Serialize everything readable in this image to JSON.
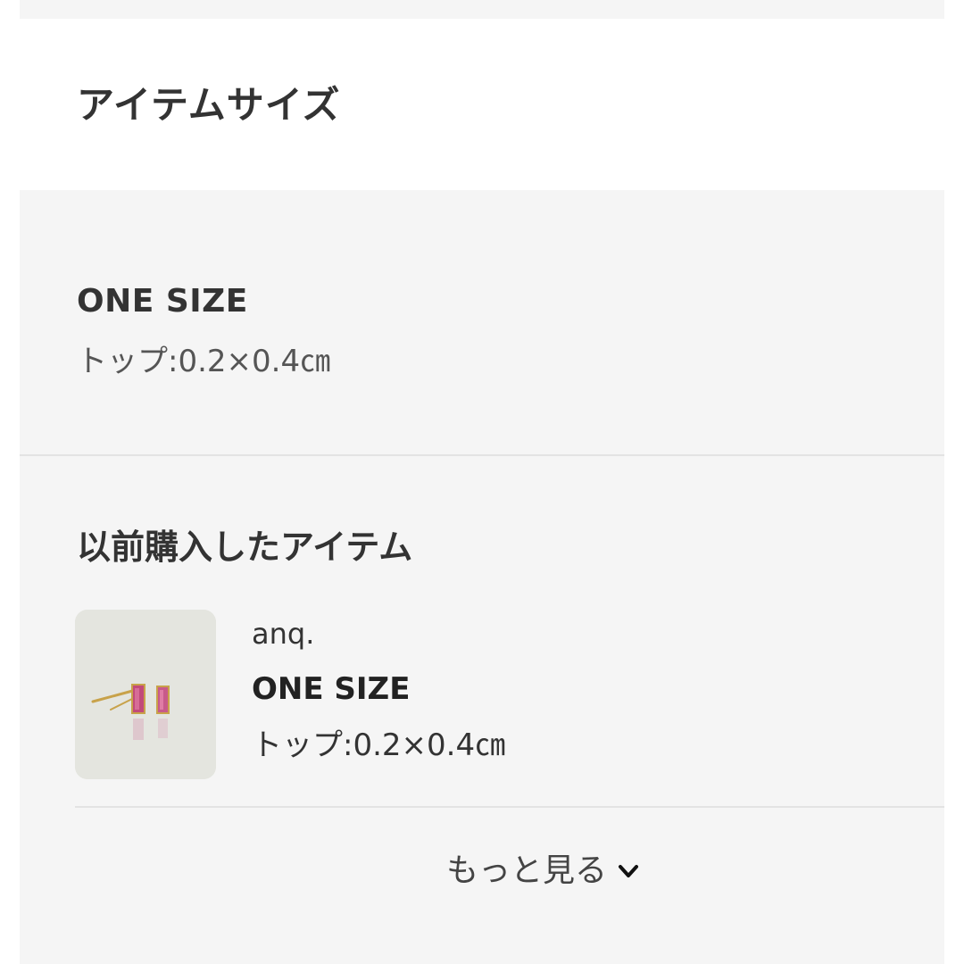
{
  "item_size": {
    "title": "アイテムサイズ"
  },
  "size_info": {
    "name": "ONE SIZE",
    "detail": "トップ:0.2×0.4㎝"
  },
  "purchase_history": {
    "title": "以前購入したアイテム",
    "items": [
      {
        "brand": "anq.",
        "size_name": "ONE SIZE",
        "size_detail": "トップ:0.2×0.4㎝",
        "thumbnail": "pink-baguette-stud-earrings"
      }
    ],
    "more_label": "もっと見る",
    "more_icon": "chevron-down-icon"
  },
  "colors": {
    "panel_bg": "#f5f5f5",
    "text": "#333333",
    "divider": "#e3e3e3",
    "thumb_bg": "#e4e5df",
    "gem": "#c24a7a",
    "gold": "#c8a24a"
  }
}
